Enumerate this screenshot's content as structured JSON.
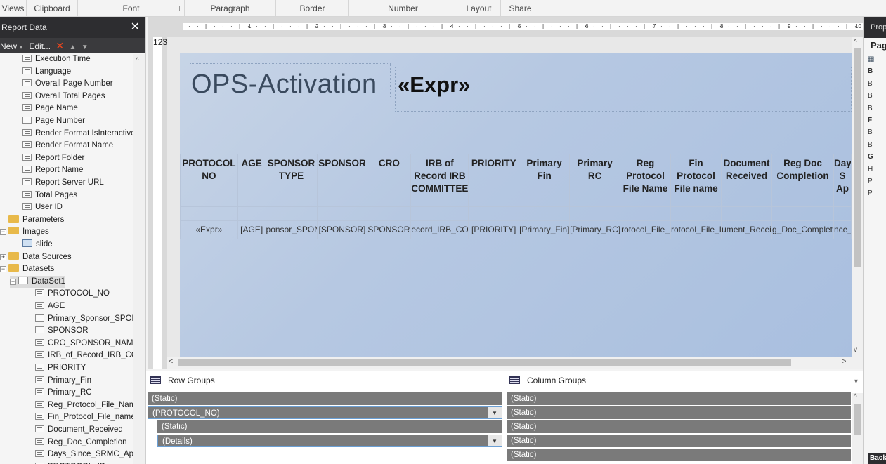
{
  "ribbon": {
    "groups": [
      {
        "label": "Views",
        "launcher": false
      },
      {
        "label": "Clipboard",
        "launcher": false
      },
      {
        "label": "Font",
        "launcher": true
      },
      {
        "label": "Paragraph",
        "launcher": true
      },
      {
        "label": "Border",
        "launcher": true
      },
      {
        "label": "Number",
        "launcher": true
      },
      {
        "label": "Layout",
        "launcher": false
      },
      {
        "label": "Share",
        "launcher": false
      }
    ]
  },
  "report_data": {
    "title": "Report Data",
    "close_glyph": "✕",
    "toolbar": {
      "new_label": "New",
      "edit_label": "Edit...",
      "delete_glyph": "✕",
      "up_glyph": "▲",
      "down_glyph": "▼"
    },
    "items": [
      {
        "label": "Execution Time",
        "kind": "field",
        "indent": 1
      },
      {
        "label": "Language",
        "kind": "field",
        "indent": 1
      },
      {
        "label": "Overall Page Number",
        "kind": "field",
        "indent": 1
      },
      {
        "label": "Overall Total Pages",
        "kind": "field",
        "indent": 1
      },
      {
        "label": "Page Name",
        "kind": "field",
        "indent": 1
      },
      {
        "label": "Page Number",
        "kind": "field",
        "indent": 1
      },
      {
        "label": "Render Format IsInteractive",
        "kind": "field",
        "indent": 1
      },
      {
        "label": "Render Format Name",
        "kind": "field",
        "indent": 1
      },
      {
        "label": "Report Folder",
        "kind": "field",
        "indent": 1
      },
      {
        "label": "Report Name",
        "kind": "field",
        "indent": 1
      },
      {
        "label": "Report Server URL",
        "kind": "field",
        "indent": 1
      },
      {
        "label": "Total Pages",
        "kind": "field",
        "indent": 1
      },
      {
        "label": "User ID",
        "kind": "field",
        "indent": 1
      },
      {
        "label": "Parameters",
        "kind": "folder",
        "indent": 0,
        "expander": ""
      },
      {
        "label": "Images",
        "kind": "folder",
        "indent": 0,
        "expander": "−"
      },
      {
        "label": "slide",
        "kind": "image",
        "indent": 1
      },
      {
        "label": "Data Sources",
        "kind": "folder",
        "indent": 0,
        "expander": "+"
      },
      {
        "label": "Datasets",
        "kind": "folder",
        "indent": 0,
        "expander": "−"
      },
      {
        "label": "DataSet1",
        "kind": "dataset",
        "indent": 1,
        "expander": "−",
        "selected": true
      },
      {
        "label": "PROTOCOL_NO",
        "kind": "field",
        "indent": 2
      },
      {
        "label": "AGE",
        "kind": "field",
        "indent": 2
      },
      {
        "label": "Primary_Sponsor_SPONS",
        "kind": "field",
        "indent": 2
      },
      {
        "label": "SPONSOR",
        "kind": "field",
        "indent": 2
      },
      {
        "label": "CRO_SPONSOR_NAME",
        "kind": "field",
        "indent": 2
      },
      {
        "label": "IRB_of_Record_IRB_COM",
        "kind": "field",
        "indent": 2
      },
      {
        "label": "PRIORITY",
        "kind": "field",
        "indent": 2
      },
      {
        "label": "Primary_Fin",
        "kind": "field",
        "indent": 2
      },
      {
        "label": "Primary_RC",
        "kind": "field",
        "indent": 2
      },
      {
        "label": "Reg_Protocol_File_Name",
        "kind": "field",
        "indent": 2
      },
      {
        "label": "Fin_Protocol_File_name",
        "kind": "field",
        "indent": 2
      },
      {
        "label": "Document_Received",
        "kind": "field",
        "indent": 2
      },
      {
        "label": "Reg_Doc_Completion",
        "kind": "field",
        "indent": 2
      },
      {
        "label": "Days_Since_SRMC_Appro",
        "kind": "field",
        "indent": 2
      },
      {
        "label": "PROTOCOL_ID",
        "kind": "field",
        "indent": 2
      }
    ]
  },
  "ruler": {
    "numbers": [
      "1",
      "2",
      "3",
      "4",
      "5",
      "6",
      "7",
      "8",
      "9",
      "10"
    ],
    "v_numbers": [
      "1",
      "2",
      "3"
    ]
  },
  "report": {
    "title": "OPS-Activation",
    "expr_header": "«Expr»",
    "columns": [
      {
        "header": "PROTOCOL NO",
        "cell": "«Expr»"
      },
      {
        "header": "AGE",
        "cell": "[AGE]"
      },
      {
        "header": "SPONSOR TYPE",
        "cell": "ponsor_SPON"
      },
      {
        "header": "SPONSOR",
        "cell": "[SPONSOR]"
      },
      {
        "header": "CRO",
        "cell": "SPONSOR_I"
      },
      {
        "header": "IRB of Record IRB COMMITTEE",
        "cell": "ecord_IRB_COI"
      },
      {
        "header": "PRIORITY",
        "cell": "[PRIORITY]"
      },
      {
        "header": "Primary Fin",
        "cell": "[Primary_Fin]"
      },
      {
        "header": "Primary RC",
        "cell": "[Primary_RC]"
      },
      {
        "header": "Reg Protocol File Name",
        "cell": "rotocol_File_"
      },
      {
        "header": "Fin Protocol File name",
        "cell": "rotocol_File_I"
      },
      {
        "header": "Document Received",
        "cell": "ument_Recei"
      },
      {
        "header": "Reg Doc Completion",
        "cell": "g_Doc_Completi"
      },
      {
        "header": "Day S Ap",
        "cell": "nce_"
      }
    ]
  },
  "row_groups": {
    "title": "Row Groups",
    "rows": [
      {
        "label": "(Static)",
        "indent": 0,
        "dropdown": false
      },
      {
        "label": "(PROTOCOL_NO)",
        "indent": 0,
        "dropdown": true
      },
      {
        "label": "(Static)",
        "indent": 1,
        "dropdown": false
      },
      {
        "label": "(Details)",
        "indent": 1,
        "dropdown": true
      }
    ]
  },
  "column_groups": {
    "title": "Column Groups",
    "rows": [
      "(Static)",
      "(Static)",
      "(Static)",
      "(Static)",
      "(Static)"
    ]
  },
  "properties": {
    "title": "Prop",
    "page_label": "Pag",
    "rows": [
      "B",
      "B",
      "B",
      "B",
      "F",
      "B",
      "B",
      "G",
      "H",
      "P",
      "P"
    ],
    "back_label": "Back"
  },
  "colors": {
    "accent_delete": "#e8461e",
    "page_gradient": "#b6c8e2",
    "group_row": "#7a7a7a"
  }
}
